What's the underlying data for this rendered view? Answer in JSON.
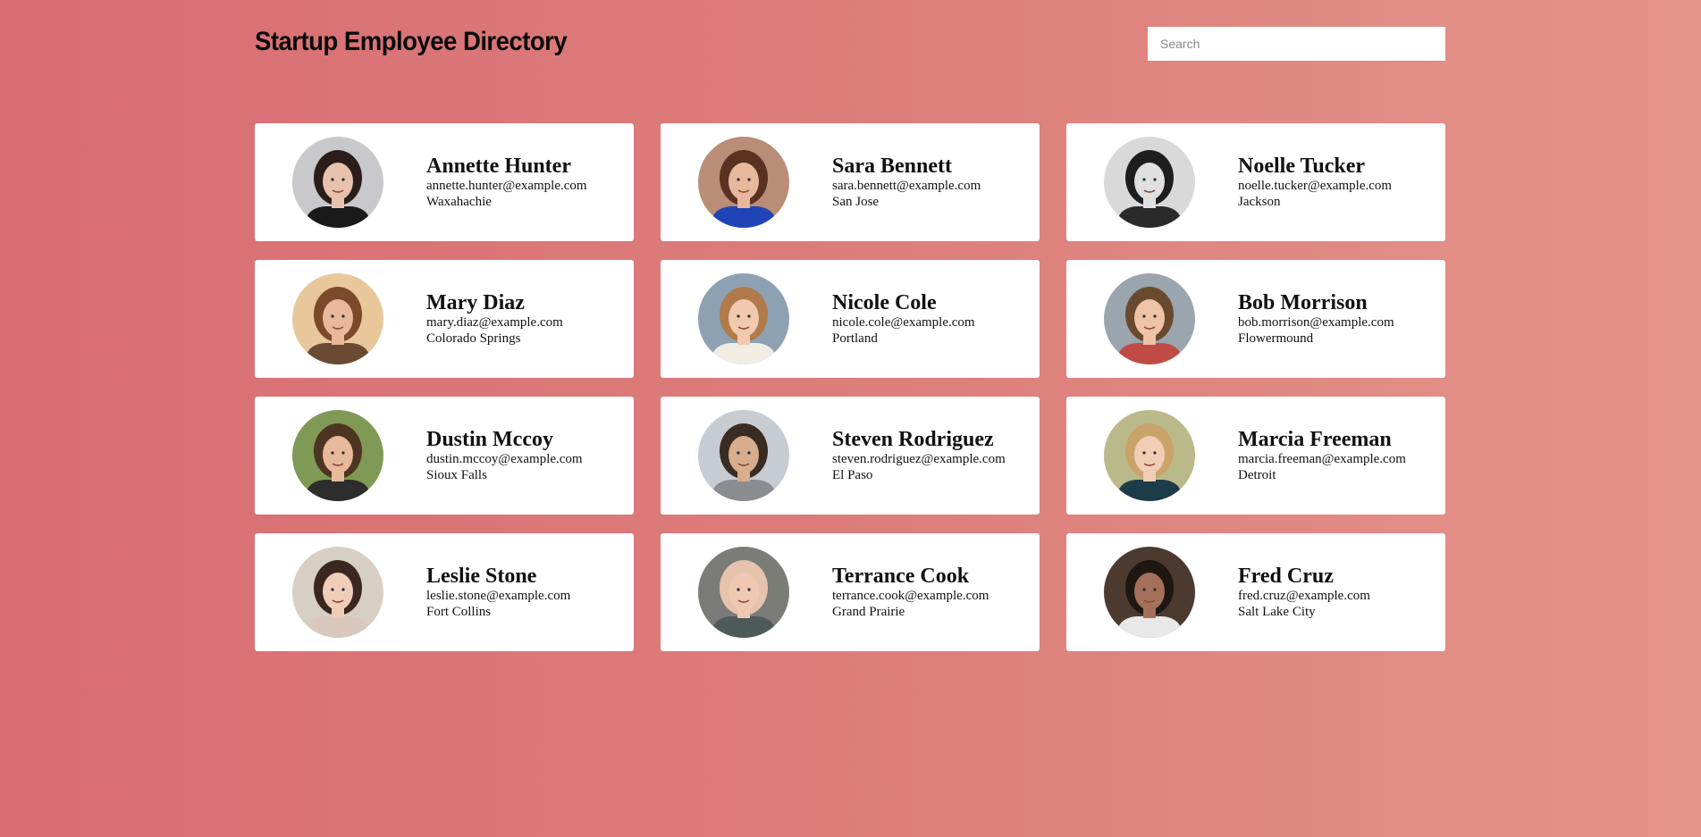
{
  "header": {
    "title": "Startup Employee Directory",
    "search_placeholder": "Search"
  },
  "employees": [
    {
      "name": "Annette Hunter",
      "email": "annette.hunter@example.com",
      "city": "Waxahachie",
      "bg": "#c9c9cc",
      "hair": "#2a1d1a",
      "skin": "#e7c2ad",
      "shirt": "#1a1a1a"
    },
    {
      "name": "Sara Bennett",
      "email": "sara.bennett@example.com",
      "city": "San Jose",
      "bg": "#b98d77",
      "hair": "#5b3222",
      "skin": "#e8b89c",
      "shirt": "#1f44b5"
    },
    {
      "name": "Noelle Tucker",
      "email": "noelle.tucker@example.com",
      "city": "Jackson",
      "bg": "#d9d9d9",
      "hair": "#1e1e1e",
      "skin": "#e0e0e0",
      "shirt": "#2a2a2a"
    },
    {
      "name": "Mary Diaz",
      "email": "mary.diaz@example.com",
      "city": "Colorado Springs",
      "bg": "#e8c89b",
      "hair": "#7a4a2a",
      "skin": "#e9b79a",
      "shirt": "#6b4a33"
    },
    {
      "name": "Nicole Cole",
      "email": "nicole.cole@example.com",
      "city": "Portland",
      "bg": "#8ea1b3",
      "hair": "#b07a4a",
      "skin": "#f0c9ae",
      "shirt": "#f2ede4"
    },
    {
      "name": "Bob Morrison",
      "email": "bob.morrison@example.com",
      "city": "Flowermound",
      "bg": "#9aa5ad",
      "hair": "#6a4a2e",
      "skin": "#efc3a8",
      "shirt": "#c04b45"
    },
    {
      "name": "Dustin Mccoy",
      "email": "dustin.mccoy@example.com",
      "city": "Sioux Falls",
      "bg": "#7f9a54",
      "hair": "#4e3423",
      "skin": "#e7b99a",
      "shirt": "#2d2d2d"
    },
    {
      "name": "Steven Rodriguez",
      "email": "steven.rodriguez@example.com",
      "city": "El Paso",
      "bg": "#c6ccd2",
      "hair": "#3a2c22",
      "skin": "#d8ad8e",
      "shirt": "#8b8d90"
    },
    {
      "name": "Marcia Freeman",
      "email": "marcia.freeman@example.com",
      "city": "Detroit",
      "bg": "#b9b98a",
      "hair": "#c9a36a",
      "skin": "#f1cdb5",
      "shirt": "#1d3c4a"
    },
    {
      "name": "Leslie Stone",
      "email": "leslie.stone@example.com",
      "city": "Fort Collins",
      "bg": "#d8cfc4",
      "hair": "#3a2820",
      "skin": "#f0cdb9",
      "shirt": "#d9c8bb"
    },
    {
      "name": "Terrance Cook",
      "email": "terrance.cook@example.com",
      "city": "Grand Prairie",
      "bg": "#7b7b78",
      "hair": "#e6c3ad",
      "skin": "#efc8b4",
      "shirt": "#4d5a58"
    },
    {
      "name": "Fred Cruz",
      "email": "fred.cruz@example.com",
      "city": "Salt Lake City",
      "bg": "#4d3a2e",
      "hair": "#1e1712",
      "skin": "#a4705a",
      "shirt": "#e8e8e8"
    }
  ]
}
